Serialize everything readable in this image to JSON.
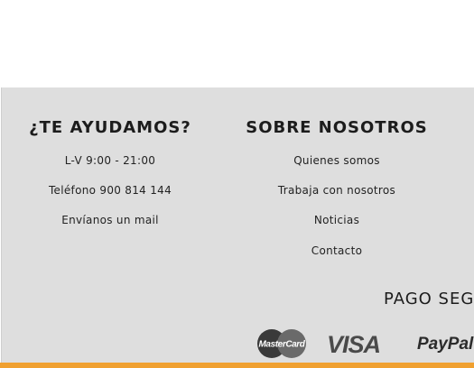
{
  "help": {
    "title": "¿TE AYUDAMOS?",
    "hours": "L-V 9:00 - 21:00",
    "phone": "Teléfono 900 814 144",
    "mail": "Envíanos un mail"
  },
  "about": {
    "title": "SOBRE NOSOTROS",
    "links": [
      "Quienes somos",
      "Trabaja con nosotros",
      "Noticias",
      "Contacto"
    ]
  },
  "payment": {
    "title": "PAGO SEG",
    "mastercard_text": "MasterCard",
    "visa_text": "VISA",
    "paypal_text": "PayPal"
  },
  "colors": {
    "footer_bg": "#dedede",
    "accent": "#f0a030",
    "mastercard_dark": "#3a3a3a",
    "mastercard_light": "#6a6a6a"
  }
}
